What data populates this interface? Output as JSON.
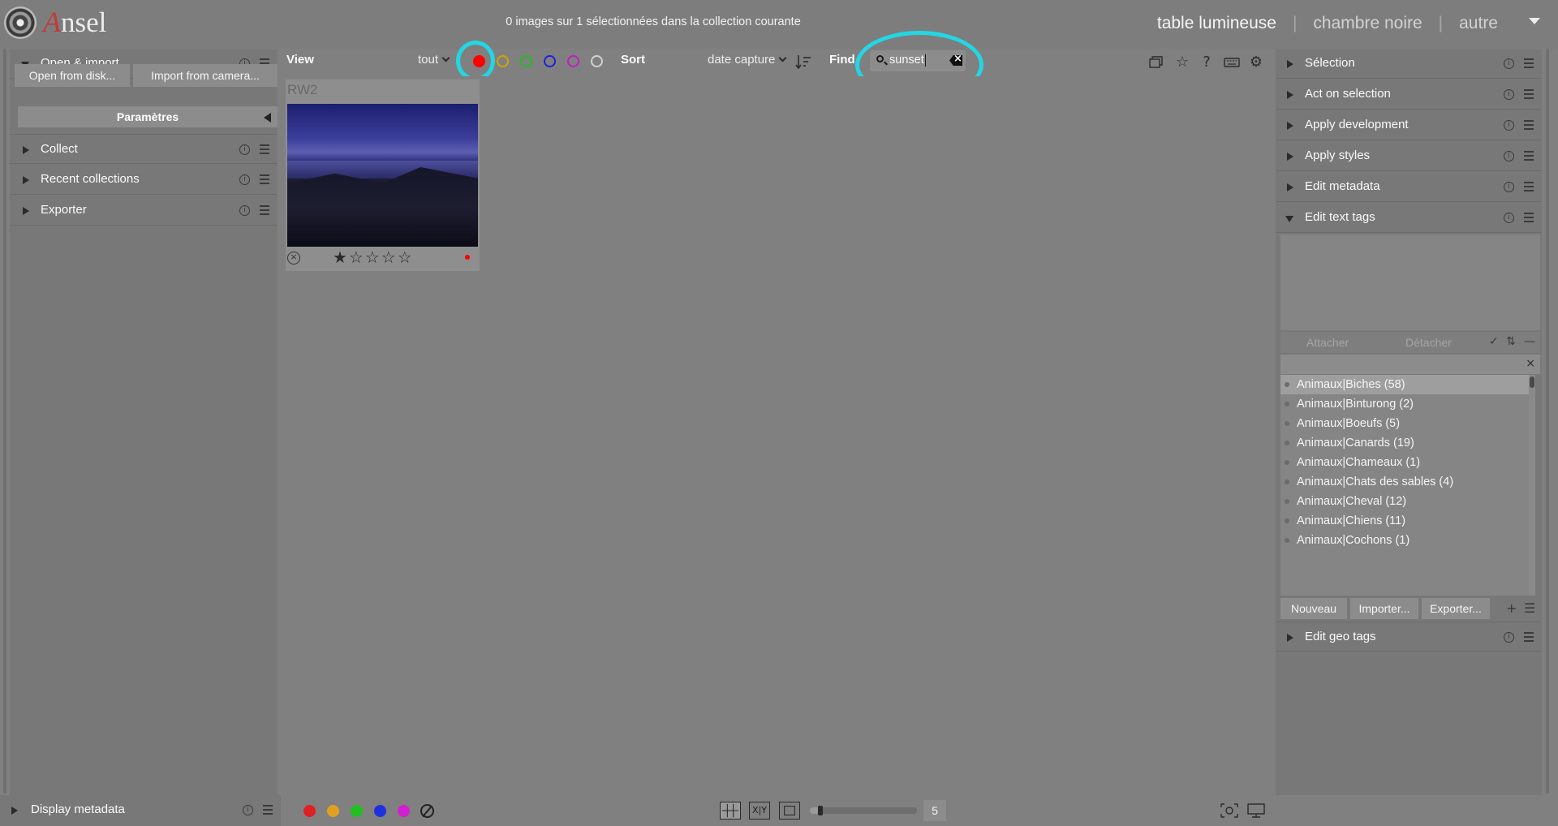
{
  "app": {
    "logo_first": "A",
    "logo_rest": "nsel"
  },
  "header": {
    "status": "0 images sur 1 sélectionnées dans la collection courante",
    "views": [
      "table lumineuse",
      "chambre noire",
      "autre"
    ]
  },
  "left_panel": {
    "open_import": {
      "label": "Open & import",
      "open_disk": "Open from disk...",
      "import_camera": "Import from camera...",
      "params": "Paramètres"
    },
    "collect": "Collect",
    "recent": "Recent collections",
    "exporter": "Exporter",
    "display_metadata": "Display metadata"
  },
  "toolbar": {
    "view_label": "View",
    "view_value": "tout",
    "sort_label": "Sort",
    "sort_value": "date capture",
    "find_label": "Find",
    "find_value": "sunset",
    "color_filters": [
      "#ff0000",
      "#d4a000",
      "#1fbf1f",
      "#2020d8",
      "#c020c0",
      "#d0d0d0"
    ],
    "active_color_filter": "red"
  },
  "thumbnail": {
    "extension": "RW2",
    "rating": 1,
    "max_rating": 5,
    "color_label": "#ff0000"
  },
  "right_panel": {
    "modules": [
      "Sélection",
      "Act on selection",
      "Apply development",
      "Apply styles",
      "Edit metadata",
      "Edit text tags",
      "Edit geo tags"
    ],
    "tags": {
      "attach": "Attacher",
      "detach": "Détacher",
      "items": [
        "Animaux|Biches (58)",
        "Animaux|Binturong (2)",
        "Animaux|Boeufs (5)",
        "Animaux|Canards (19)",
        "Animaux|Chameaux (1)",
        "Animaux|Chats des sables (4)",
        "Animaux|Cheval (12)",
        "Animaux|Chiens (11)",
        "Animaux|Cochons (1)"
      ],
      "new": "Nouveau",
      "import": "Importer...",
      "export": "Exporter..."
    }
  },
  "bottom": {
    "color_labels": [
      "#e02020",
      "#e0a020",
      "#20c020",
      "#2030e0",
      "#d020d0"
    ],
    "zoom": "5",
    "zoom_fraction": 0.1
  }
}
